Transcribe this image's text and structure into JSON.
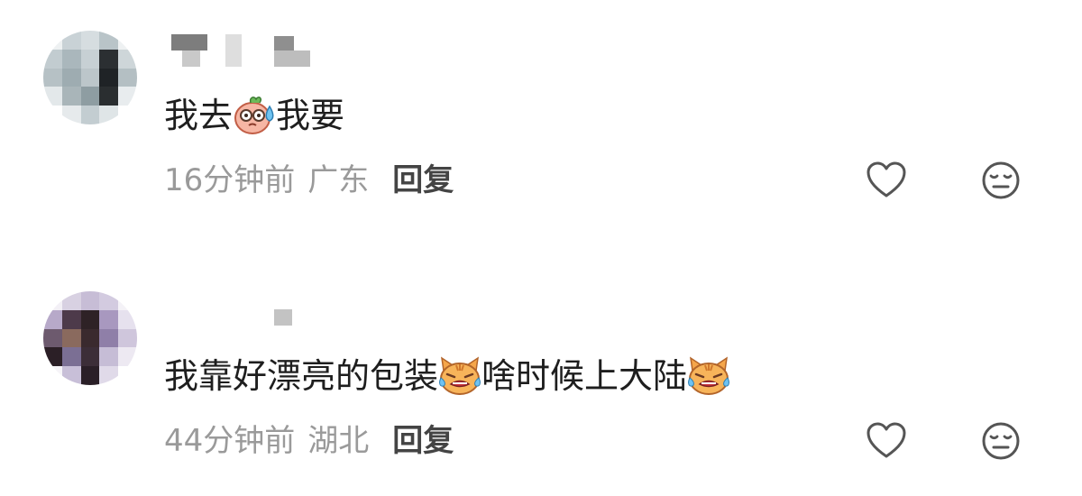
{
  "comments": [
    {
      "text_parts": [
        "我去",
        "我要"
      ],
      "emojis": [
        "sweat-face-emoji"
      ],
      "time": "16分钟前",
      "location": "广东",
      "reply_label": "回复",
      "icons": [
        "heart-icon",
        "dislike-face-icon"
      ]
    },
    {
      "text_parts": [
        "我靠好漂亮的包装",
        "啥时候上大陆"
      ],
      "emojis": [
        "crying-cat-emoji",
        "crying-cat-emoji"
      ],
      "time": "44分钟前",
      "location": "湖北",
      "reply_label": "回复",
      "icons": [
        "heart-icon",
        "dislike-face-icon"
      ]
    }
  ]
}
